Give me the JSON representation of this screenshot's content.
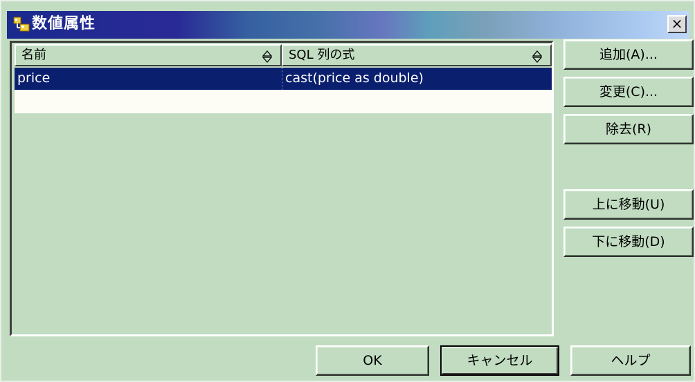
{
  "window": {
    "title": "数値属性",
    "close_label": "×"
  },
  "table": {
    "columns": [
      {
        "label": "名前"
      },
      {
        "label": "SQL 列の式"
      }
    ],
    "rows": [
      {
        "name": "price",
        "sql": "cast(price as double)"
      }
    ],
    "selected_row": 0
  },
  "side_buttons": {
    "add": "追加(A)...",
    "change": "変更(C)...",
    "remove": "除去(R)",
    "move_up": "上に移動(U)",
    "move_down": "下に移動(D)"
  },
  "bottom_buttons": {
    "ok": "OK",
    "cancel": "キャンセル",
    "help": "ヘルプ"
  },
  "icons": {
    "title": "folder-icon",
    "sort": "sort-icon"
  },
  "colors": {
    "background": "#c1dcc1",
    "selection": "#0a1f6e",
    "empty_row": "#fdfdf5",
    "title_start": "#1a2a8e",
    "title_end": "#c0d8f8"
  }
}
